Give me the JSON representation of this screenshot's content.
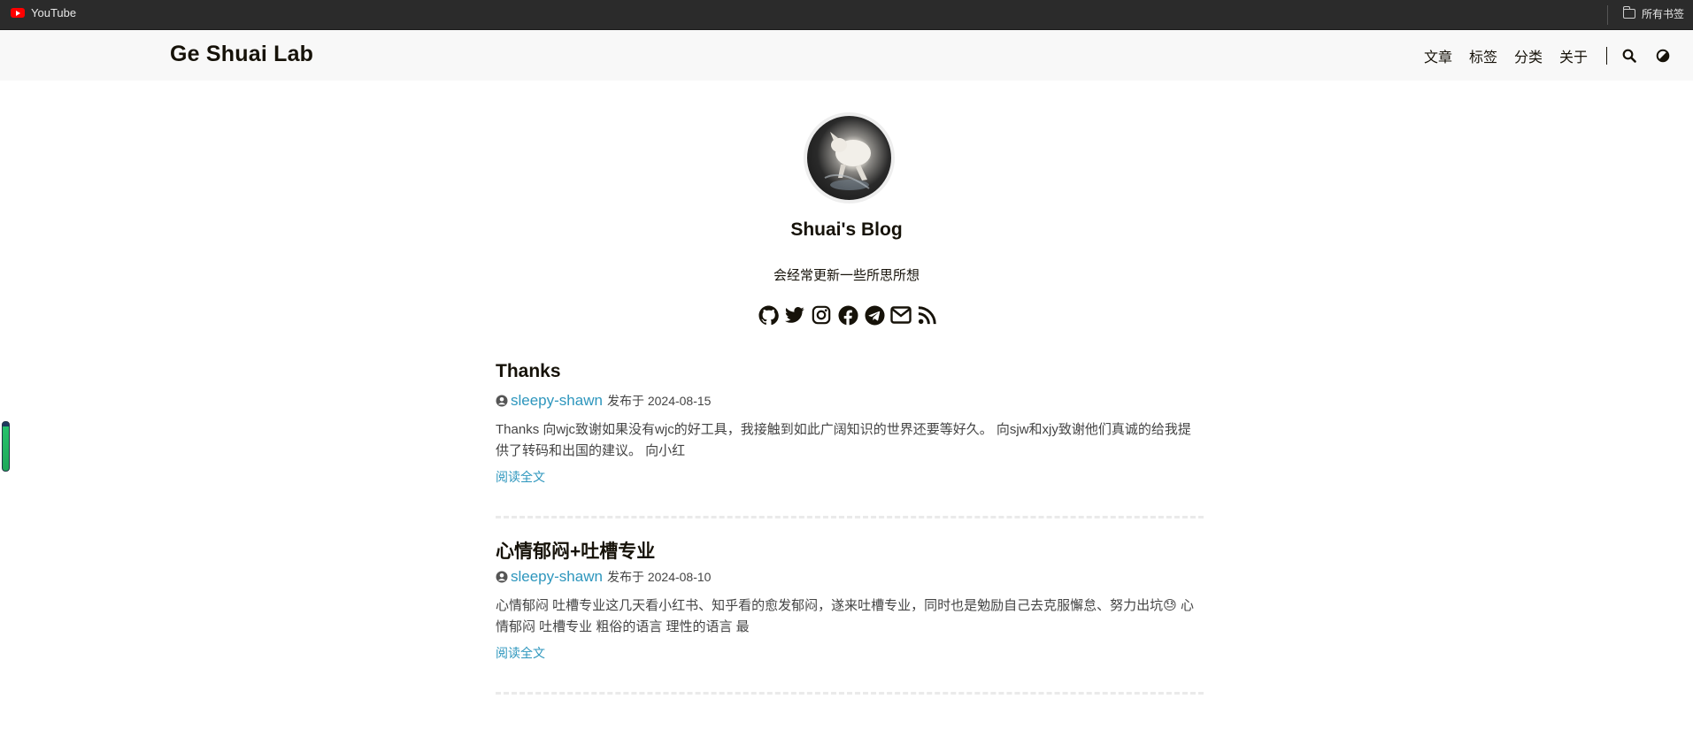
{
  "browser": {
    "bookmarks": [
      {
        "label": "YouTube",
        "icon": "youtube-icon"
      }
    ],
    "all_bookmarks_label": "所有书签"
  },
  "site": {
    "logo": "Ge Shuai Lab",
    "nav": [
      {
        "label": "文章"
      },
      {
        "label": "标签"
      },
      {
        "label": "分类"
      },
      {
        "label": "关于"
      }
    ],
    "nav_icons": [
      "search-icon",
      "theme-toggle-icon"
    ]
  },
  "profile": {
    "title": "Shuai's Blog",
    "subtitle": "会经常更新一些所思所想",
    "social": [
      "github-icon",
      "twitter-icon",
      "instagram-icon",
      "facebook-icon",
      "telegram-icon",
      "email-icon",
      "rss-icon"
    ]
  },
  "posts": [
    {
      "title": "Thanks",
      "author": "sleepy-shawn",
      "published_prefix": "发布于",
      "date": "2024-08-15",
      "summary": "Thanks 向wjc致谢如果没有wjc的好工具，我接触到如此广阔知识的世界还要等好久。 向sjw和xjy致谢他们真诚的给我提供了转码和出国的建议。 向小红",
      "read_more": "阅读全文"
    },
    {
      "title": "心情郁闷+吐槽专业",
      "author": "sleepy-shawn",
      "published_prefix": "发布于",
      "date": "2024-08-10",
      "summary": "心情郁闷 吐槽专业这几天看小红书、知乎看的愈发郁闷，遂来吐槽专业，同时也是勉励自己去克服懈怠、努力出坑😓 心情郁闷 吐槽专业 粗俗的语言 理性的语言 最",
      "read_more": "阅读全文"
    }
  ],
  "colors": {
    "accent_link": "#2d96bd",
    "text": "#161209",
    "header_bg": "#f8f8f8",
    "bookmarks_bg": "#2b2b2b"
  }
}
